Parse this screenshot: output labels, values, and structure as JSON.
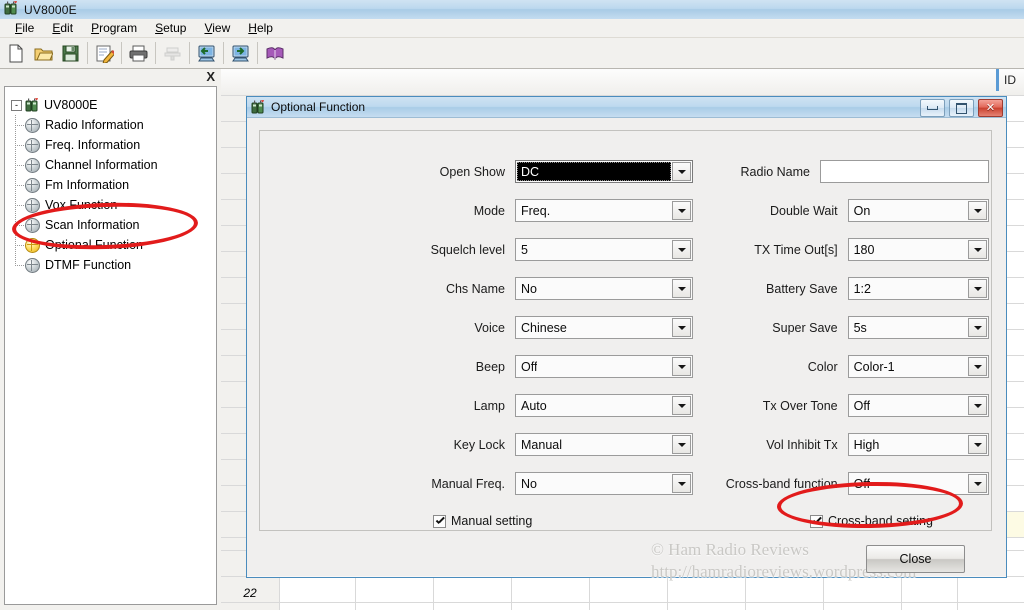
{
  "window": {
    "title": "UV8000E",
    "icon": "radio-icon"
  },
  "menu": {
    "items": [
      {
        "label": "File",
        "accel": "F"
      },
      {
        "label": "Edit",
        "accel": "E"
      },
      {
        "label": "Program",
        "accel": "P"
      },
      {
        "label": "Setup",
        "accel": "S"
      },
      {
        "label": "View",
        "accel": "V"
      },
      {
        "label": "Help",
        "accel": "H"
      }
    ]
  },
  "toolbar": {
    "buttons": [
      {
        "name": "new-file-icon",
        "enabled": true
      },
      {
        "name": "open-folder-icon",
        "enabled": true
      },
      {
        "name": "save-disk-icon",
        "enabled": true
      },
      {
        "name": "edit-pencil-icon",
        "enabled": true
      },
      {
        "name": "print-icon",
        "enabled": true
      },
      {
        "name": "print-preview-icon",
        "enabled": false
      },
      {
        "name": "read-from-radio-icon",
        "enabled": true
      },
      {
        "name": "write-to-radio-icon",
        "enabled": true
      },
      {
        "name": "help-book-icon",
        "enabled": true
      }
    ]
  },
  "sidebar": {
    "close_label": "X",
    "root": {
      "label": "UV8000E",
      "icon": "radio-icon",
      "expander": "-"
    },
    "items": [
      {
        "label": "Radio Information",
        "selected": false
      },
      {
        "label": "Freq. Information",
        "selected": false
      },
      {
        "label": "Channel Information",
        "selected": false
      },
      {
        "label": "Fm Information",
        "selected": false
      },
      {
        "label": "Vox Function",
        "selected": false
      },
      {
        "label": "Scan Information",
        "selected": false
      },
      {
        "label": "Optional Function",
        "selected": true
      },
      {
        "label": "DTMF Function",
        "selected": false
      }
    ]
  },
  "grid": {
    "header_id": "ID",
    "row_number": "22"
  },
  "dialog": {
    "title": "Optional Function",
    "icon": "radio-icon",
    "window_buttons": {
      "minimize": "minimize-button",
      "maximize": "maximize-button",
      "close": "close-button"
    },
    "left_fields": [
      {
        "label": "Open Show",
        "value": "DC",
        "type": "combo",
        "focused": true
      },
      {
        "label": "Mode",
        "value": "Freq.",
        "type": "combo",
        "focused": false
      },
      {
        "label": "Squelch level",
        "value": "5",
        "type": "combo",
        "focused": false
      },
      {
        "label": "Chs Name",
        "value": "No",
        "type": "combo",
        "focused": false
      },
      {
        "label": "Voice",
        "value": "Chinese",
        "type": "combo",
        "focused": false
      },
      {
        "label": "Beep",
        "value": "Off",
        "type": "combo",
        "focused": false
      },
      {
        "label": "Lamp",
        "value": "Auto",
        "type": "combo",
        "focused": false
      },
      {
        "label": "Key Lock",
        "value": "Manual",
        "type": "combo",
        "focused": false
      },
      {
        "label": "Manual Freq.",
        "value": "No",
        "type": "combo",
        "focused": false
      }
    ],
    "right_fields": [
      {
        "label": "Radio Name",
        "value": "",
        "type": "text"
      },
      {
        "label": "Double Wait",
        "value": "On",
        "type": "combo"
      },
      {
        "label": "TX Time Out[s]",
        "value": "180",
        "type": "combo"
      },
      {
        "label": "Battery Save",
        "value": "1:2",
        "type": "combo"
      },
      {
        "label": "Super Save",
        "value": "5s",
        "type": "combo"
      },
      {
        "label": "Color",
        "value": "Color-1",
        "type": "combo"
      },
      {
        "label": "Tx Over Tone",
        "value": "Off",
        "type": "combo"
      },
      {
        "label": "Vol Inhibit Tx",
        "value": "High",
        "type": "combo"
      },
      {
        "label": "Cross-band function",
        "value": "Off",
        "type": "combo"
      }
    ],
    "checkboxes": [
      {
        "label": "Manual setting",
        "checked": true
      },
      {
        "label": "Cross-band setting",
        "checked": true
      }
    ],
    "close_label": "Close"
  },
  "watermark": {
    "line1": "© Ham Radio Reviews",
    "line2": "http://hamradioreviews.wordpress.com"
  },
  "colors": {
    "annotation": "#e21b1b",
    "title_accent": "#a9cce7",
    "selected_node": "#ffe169"
  }
}
